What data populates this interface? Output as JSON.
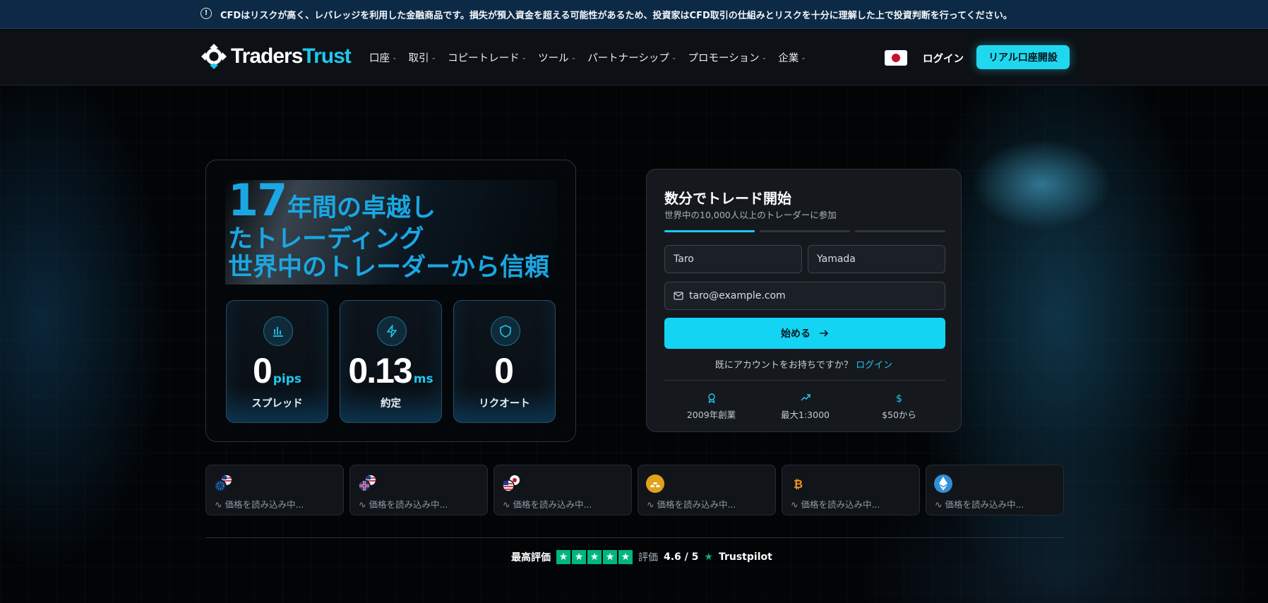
{
  "banner": {
    "text": "CFDはリスクが高く、レバレッジを利用した金融商品です。損失が預入資金を超える可能性があるため、投資家はCFD取引の仕組みとリスクを十分に理解した上で投資判断を行ってください。",
    "icon": "info-icon"
  },
  "nav": {
    "logo_part1": "Traders",
    "logo_part2": "Trust",
    "items": [
      {
        "label": "口座"
      },
      {
        "label": "取引"
      },
      {
        "label": "コピートレード"
      },
      {
        "label": "ツール"
      },
      {
        "label": "パートナーシップ"
      },
      {
        "label": "プロモーション"
      },
      {
        "label": "企業"
      }
    ],
    "login": "ログイン",
    "cta": "リアル口座開設",
    "flag": "japan-flag-icon"
  },
  "hero": {
    "num": "17",
    "line1": "年間の卓越し",
    "line2": "たトレーディング",
    "line3": "世界中のトレーダーから信頼",
    "stats": [
      {
        "value": "0",
        "unit": "pips",
        "label": "スプレッド",
        "icon": "bar-chart-icon"
      },
      {
        "value": "0.13",
        "unit": "ms",
        "label": "約定",
        "icon": "lightning-icon"
      },
      {
        "value": "0",
        "unit": "",
        "label": "リクオート",
        "icon": "shield-icon"
      }
    ]
  },
  "form": {
    "title": "数分でトレード開始",
    "subtitle": "世界中の10,000人以上のトレーダーに参加",
    "first_name_placeholder": "Taro",
    "last_name_placeholder": "Yamada",
    "email_placeholder": "taro@example.com",
    "submit": "始める",
    "have_account": "既にアカウントをお持ちですか？",
    "login_link": "ログイン",
    "features": [
      {
        "icon": "award-icon",
        "text": "2009年創業"
      },
      {
        "icon": "trending-up-icon",
        "text": "最大1:3000"
      },
      {
        "icon": "dollar-icon",
        "text": "$50から"
      }
    ],
    "progress_step": 1,
    "progress_total": 3
  },
  "tickers": [
    {
      "icon": "eu-us-flag-icon",
      "text": "价格を読み込み中..."
    },
    {
      "icon": "gb-us-flag-icon",
      "text": "価格を読み込み中..."
    },
    {
      "icon": "us-jp-flag-icon",
      "text": "価格を読み込み中..."
    },
    {
      "icon": "gold-icon",
      "text": "価格を読み込み中..."
    },
    {
      "icon": "bitcoin-icon",
      "text": "価格を読み込み中..."
    },
    {
      "icon": "ethereum-icon",
      "text": "価格を読み込み中..."
    }
  ],
  "trustpilot": {
    "best": "最高評価",
    "rating_word": "評価",
    "score": "4.6 / 5",
    "brand": "Trustpilot"
  },
  "colors": {
    "accent": "#1ec8ee",
    "headline": "#1aa7e3",
    "trustpilot": "#00b67a"
  }
}
